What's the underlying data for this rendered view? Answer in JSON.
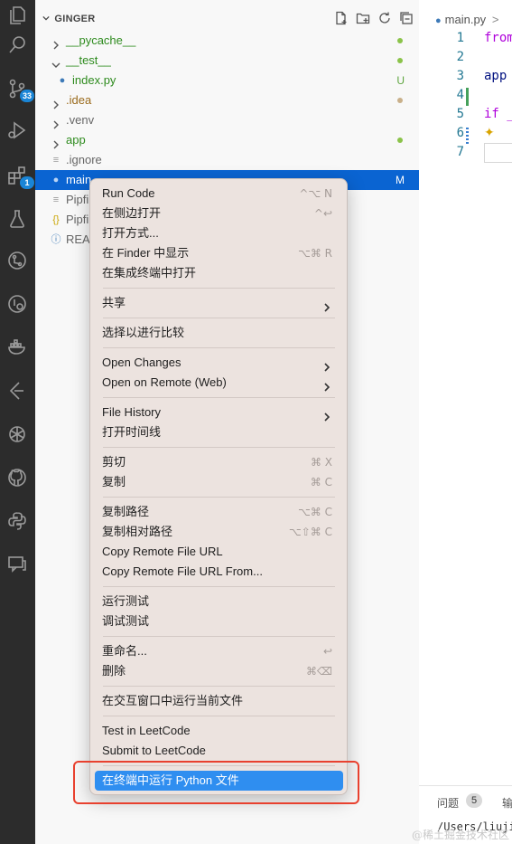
{
  "activity_bar": {
    "items": [
      {
        "icon": "files-icon"
      },
      {
        "icon": "search-icon"
      },
      {
        "icon": "source-control-icon",
        "badge": "33"
      },
      {
        "icon": "run-debug-icon"
      },
      {
        "icon": "extensions-icon",
        "badge": "1"
      },
      {
        "icon": "testing-icon"
      },
      {
        "icon": "git-graph-icon"
      },
      {
        "icon": "remote-icon"
      },
      {
        "icon": "docker-icon"
      },
      {
        "icon": "leetcode-icon"
      },
      {
        "icon": "openai-icon"
      },
      {
        "icon": "github-icon"
      },
      {
        "icon": "python-icon"
      },
      {
        "icon": "comments-icon"
      }
    ]
  },
  "explorer": {
    "title": "GINGER",
    "tree": [
      {
        "name": "__pycache__",
        "kind": "folder",
        "expanded": false,
        "color": "#2e8b1e",
        "status_dot": "#8bc34a"
      },
      {
        "name": "__test__",
        "kind": "folder",
        "expanded": true,
        "color": "#2e8b1e",
        "status_dot": "#8bc34a"
      },
      {
        "name": "index.py",
        "kind": "py",
        "color": "#2e8b1e",
        "status": "U",
        "status_color": "#5fa640"
      },
      {
        "name": ".idea",
        "kind": "folder",
        "expanded": false,
        "color": "#9a6a1c",
        "status_dot": "#c9b08a"
      },
      {
        "name": ".venv",
        "kind": "folder",
        "expanded": false,
        "color": "#666666"
      },
      {
        "name": "app",
        "kind": "folder",
        "expanded": false,
        "color": "#2e8b1e",
        "status_dot": "#8bc34a"
      },
      {
        "name": ".ignore",
        "kind": "text",
        "color": "#666666"
      },
      {
        "name": "main",
        "kind": "py",
        "color": "#ffffff",
        "status": "M",
        "selected": true
      },
      {
        "name": "Pipfi",
        "kind": "text",
        "color": "#666666"
      },
      {
        "name": "Pipfi",
        "kind": "json",
        "color": "#666666"
      },
      {
        "name": "REA",
        "kind": "info",
        "color": "#666666"
      }
    ]
  },
  "editor": {
    "tab": "main.py",
    "breadcrumb_sep": ">",
    "lines": [
      {
        "n": "1",
        "text": "from",
        "color": "#af00db"
      },
      {
        "n": "2",
        "text": "",
        "color": "#000000"
      },
      {
        "n": "3",
        "text": "app",
        "color": "#001080"
      },
      {
        "n": "4",
        "text": "",
        "color": "#000000"
      },
      {
        "n": "5",
        "text": "if _",
        "color": "#af00db"
      },
      {
        "n": "6",
        "text": "",
        "color": "#000000"
      },
      {
        "n": "7",
        "text": "",
        "color": "#000000"
      }
    ]
  },
  "panel": {
    "problems_label": "问题",
    "problems_count": "5",
    "output_label": "输",
    "terminal_text": "/Users/liuji"
  },
  "context_menu": {
    "items": [
      {
        "label": "Run Code",
        "shortcut": "^⌥ N"
      },
      {
        "label": "在侧边打开",
        "shortcut": "^↩"
      },
      {
        "label": "打开方式..."
      },
      {
        "label": "在 Finder 中显示",
        "shortcut": "⌥⌘ R"
      },
      {
        "label": "在集成终端中打开"
      },
      {
        "separator": true
      },
      {
        "label": "共享",
        "submenu": true
      },
      {
        "separator": true
      },
      {
        "label": "选择以进行比较"
      },
      {
        "separator": true
      },
      {
        "label": "Open Changes",
        "submenu": true
      },
      {
        "label": "Open on Remote (Web)",
        "submenu": true
      },
      {
        "separator": true
      },
      {
        "label": "File History",
        "submenu": true
      },
      {
        "label": "打开时间线"
      },
      {
        "separator": true
      },
      {
        "label": "剪切",
        "shortcut": "⌘ X"
      },
      {
        "label": "复制",
        "shortcut": "⌘ C"
      },
      {
        "separator": true
      },
      {
        "label": "复制路径",
        "shortcut": "⌥⌘ C"
      },
      {
        "label": "复制相对路径",
        "shortcut": "⌥⇧⌘ C"
      },
      {
        "label": "Copy Remote File URL"
      },
      {
        "label": "Copy Remote File URL From..."
      },
      {
        "separator": true
      },
      {
        "label": "运行测试"
      },
      {
        "label": "调试测试"
      },
      {
        "separator": true
      },
      {
        "label": "重命名...",
        "shortcut": "↩"
      },
      {
        "label": "删除",
        "shortcut": "⌘⌫"
      },
      {
        "separator": true
      },
      {
        "label": "在交互窗口中运行当前文件"
      },
      {
        "separator": true
      },
      {
        "label": "Test in LeetCode"
      },
      {
        "label": "Submit to LeetCode"
      },
      {
        "separator": true
      },
      {
        "label": "在终端中运行 Python 文件",
        "highlighted": true
      }
    ]
  },
  "accent_colors": {
    "selection": "#0a64d2",
    "menu_highlight": "#2f8ef0",
    "annotation_box": "#e8412f",
    "badge": "#1a85d6"
  },
  "watermark": "@稀土掘金技术社区"
}
